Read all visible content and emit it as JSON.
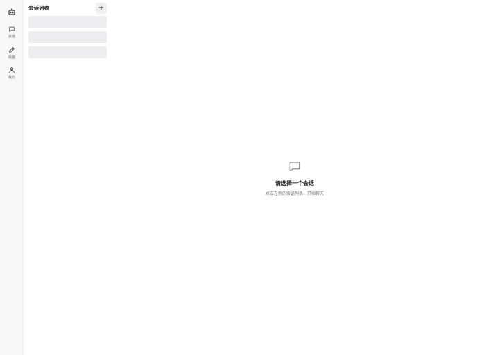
{
  "nav": {
    "logo_icon": "robot-icon",
    "items": [
      {
        "label": "会话",
        "icon": "chat-icon"
      },
      {
        "label": "绘画",
        "icon": "pencil-icon"
      },
      {
        "label": "我的",
        "icon": "user-icon"
      }
    ]
  },
  "conversations": {
    "title": "会话列表",
    "add_label": "+",
    "loading_placeholders": 3
  },
  "empty_state": {
    "icon": "chat-bubble-icon",
    "title": "请选择一个会话",
    "subtitle": "点击左侧的会话列表，开始聊天"
  },
  "colors": {
    "rail_bg": "#f8f8f9",
    "skeleton": "#eeeef0",
    "add_button_bg": "#f0f0f2"
  }
}
